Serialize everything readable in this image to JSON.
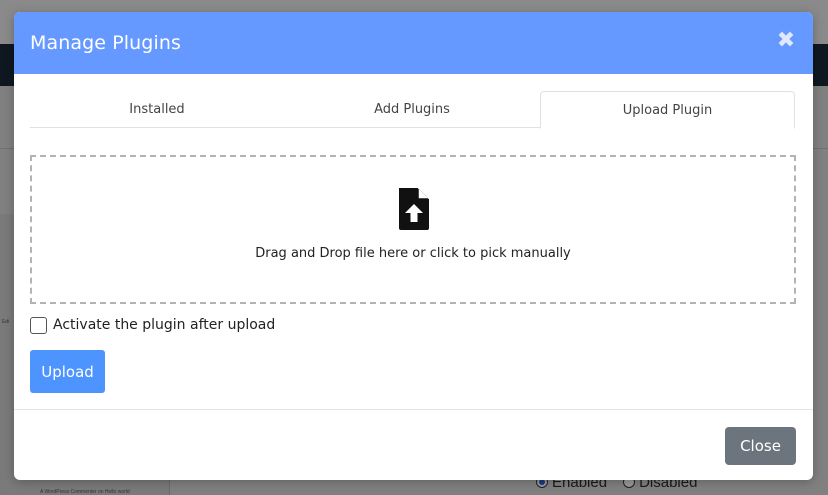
{
  "modal": {
    "title": "Manage Plugins",
    "close_icon": "close-icon",
    "header_color": "#6699ff"
  },
  "tabs": [
    {
      "label": "Installed",
      "active": false
    },
    {
      "label": "Add Plugins",
      "active": false
    },
    {
      "label": "Upload Plugin",
      "active": true
    }
  ],
  "dropzone": {
    "icon": "file-upload-icon",
    "text": "Drag and Drop file here or click to pick manually"
  },
  "activate": {
    "label": "Activate the plugin after upload",
    "checked": false
  },
  "buttons": {
    "upload_label": "Upload",
    "close_label": "Close",
    "upload_color": "#4d94ff",
    "close_color": "#6c757d"
  },
  "background": {
    "enabled_label": "Enabled",
    "disabled_label": "Disabled",
    "tiny_text_1": "Edi",
    "tiny_text_2": "A WordPress Commenter on Hello world"
  }
}
